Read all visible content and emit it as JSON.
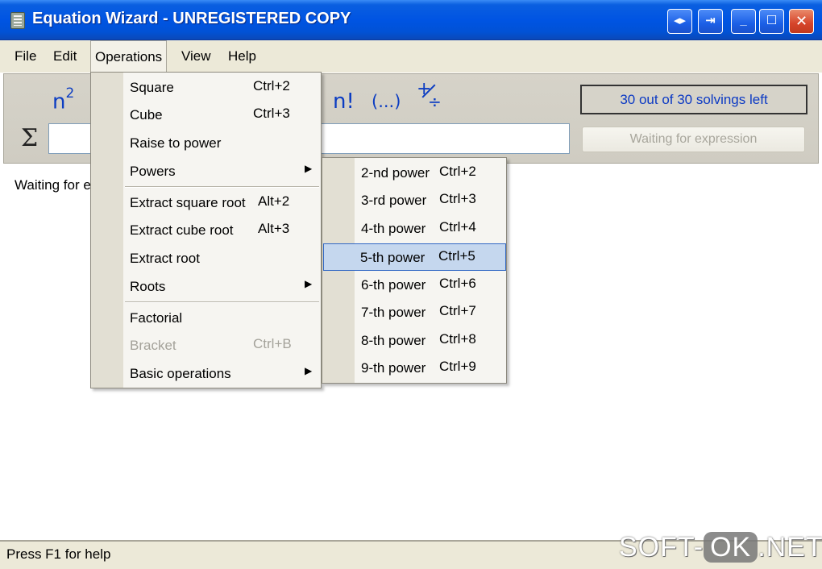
{
  "window": {
    "title": "Equation Wizard - UNREGISTERED COPY",
    "controls": {
      "back": "◂▸",
      "restore_alt": "⇥",
      "minimize": "_",
      "maximize": "☐",
      "close": "✕"
    }
  },
  "menubar": {
    "file": "File",
    "edit": "Edit",
    "operations": "Operations",
    "view": "View",
    "help": "Help"
  },
  "toolbar": {
    "square_base": "n",
    "square_exp": "2",
    "factorial": "n!",
    "bracket": "(...)",
    "plus_sign": "+",
    "divide_sign": "÷",
    "sigma": "Σ",
    "expression_value": "",
    "counter": "30 out of 30 solvings left",
    "solve_status": "Waiting for expression"
  },
  "content": {
    "waiting_text": "Waiting for e"
  },
  "status": {
    "text": "Press F1 for help",
    "watermark_left": "SOFT-",
    "watermark_mid": "OK",
    "watermark_right": ".NET"
  },
  "operations_menu": {
    "items": [
      {
        "label": "Square",
        "shortcut": "Ctrl+2"
      },
      {
        "label": "Cube",
        "shortcut": "Ctrl+3"
      },
      {
        "label": "Raise to power",
        "shortcut": ""
      },
      {
        "label": "Powers",
        "shortcut": ""
      },
      {
        "label": "Extract square root",
        "shortcut": "Alt+2"
      },
      {
        "label": "Extract cube root",
        "shortcut": "Alt+3"
      },
      {
        "label": "Extract root",
        "shortcut": ""
      },
      {
        "label": "Roots",
        "shortcut": ""
      },
      {
        "label": "Factorial",
        "shortcut": ""
      },
      {
        "label": "Bracket",
        "shortcut": "Ctrl+B"
      },
      {
        "label": "Basic operations",
        "shortcut": ""
      }
    ]
  },
  "powers_menu": {
    "items": [
      {
        "label": "2-nd power",
        "shortcut": "Ctrl+2"
      },
      {
        "label": "3-rd power",
        "shortcut": "Ctrl+3"
      },
      {
        "label": "4-th power",
        "shortcut": "Ctrl+4"
      },
      {
        "label": "5-th power",
        "shortcut": "Ctrl+5"
      },
      {
        "label": "6-th power",
        "shortcut": "Ctrl+6"
      },
      {
        "label": "7-th power",
        "shortcut": "Ctrl+7"
      },
      {
        "label": "8-th power",
        "shortcut": "Ctrl+8"
      },
      {
        "label": "9-th power",
        "shortcut": "Ctrl+9"
      }
    ]
  },
  "colors": {
    "titlebar": "#0054e3",
    "accent_blue": "#0c3dc2",
    "menu_highlight": "#c5d7ee",
    "menu_highlight_border": "#3168c4"
  }
}
